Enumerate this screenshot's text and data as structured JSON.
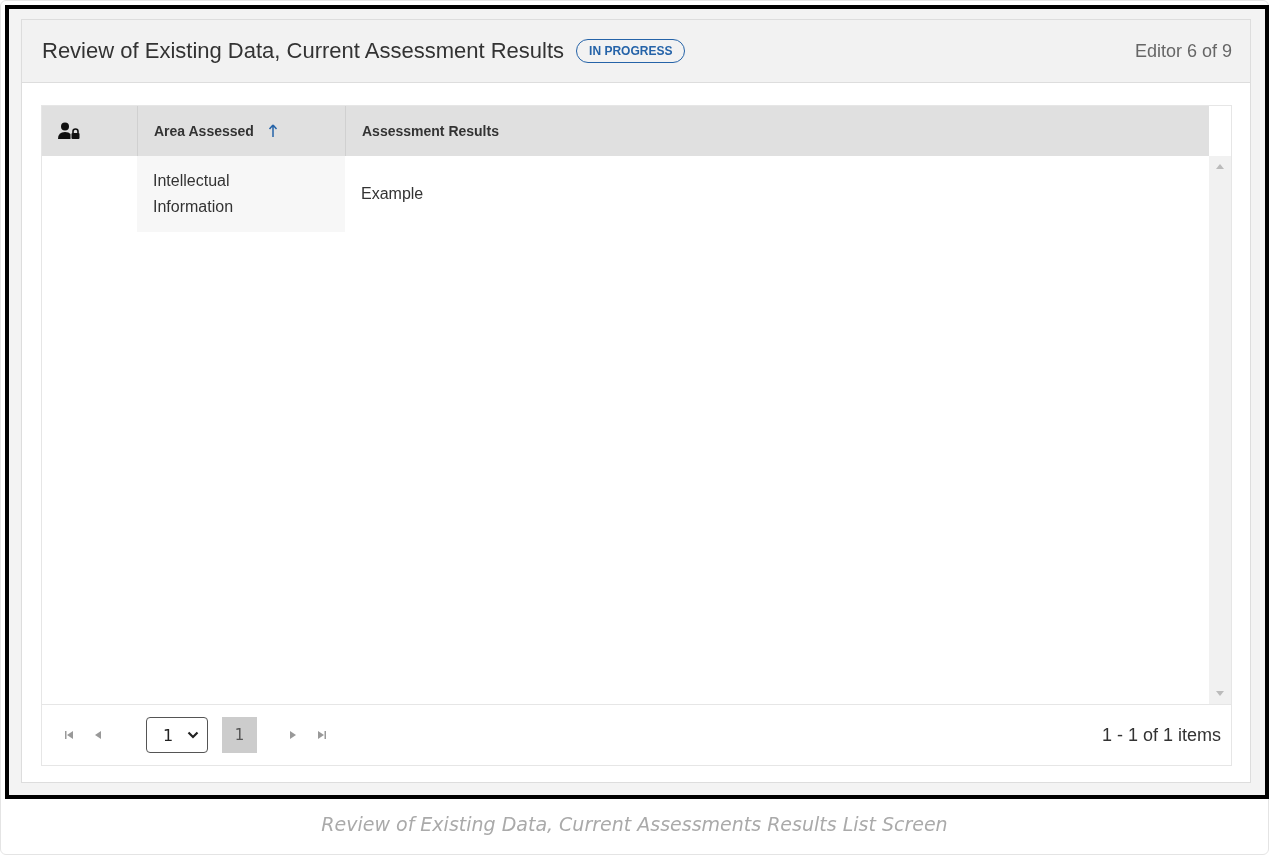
{
  "header": {
    "title": "Review of Existing Data, Current Assessment Results",
    "status": "IN PROGRESS",
    "editor": "Editor 6 of 9"
  },
  "table": {
    "columns": [
      {
        "kind": "icon"
      },
      {
        "kind": "text",
        "label": "Area Assessed",
        "sorted": true
      },
      {
        "kind": "text",
        "label": "Assessment Results",
        "sorted": false
      }
    ],
    "rows": [
      {
        "area": "Intellectual Information",
        "results": "Example"
      }
    ]
  },
  "pager": {
    "page_select": "1",
    "pages": [
      {
        "label": "1",
        "selected": true
      }
    ],
    "summary": "1 - 1 of 1 items"
  },
  "caption": "Review of Existing Data, Current Assessments Results List Screen"
}
